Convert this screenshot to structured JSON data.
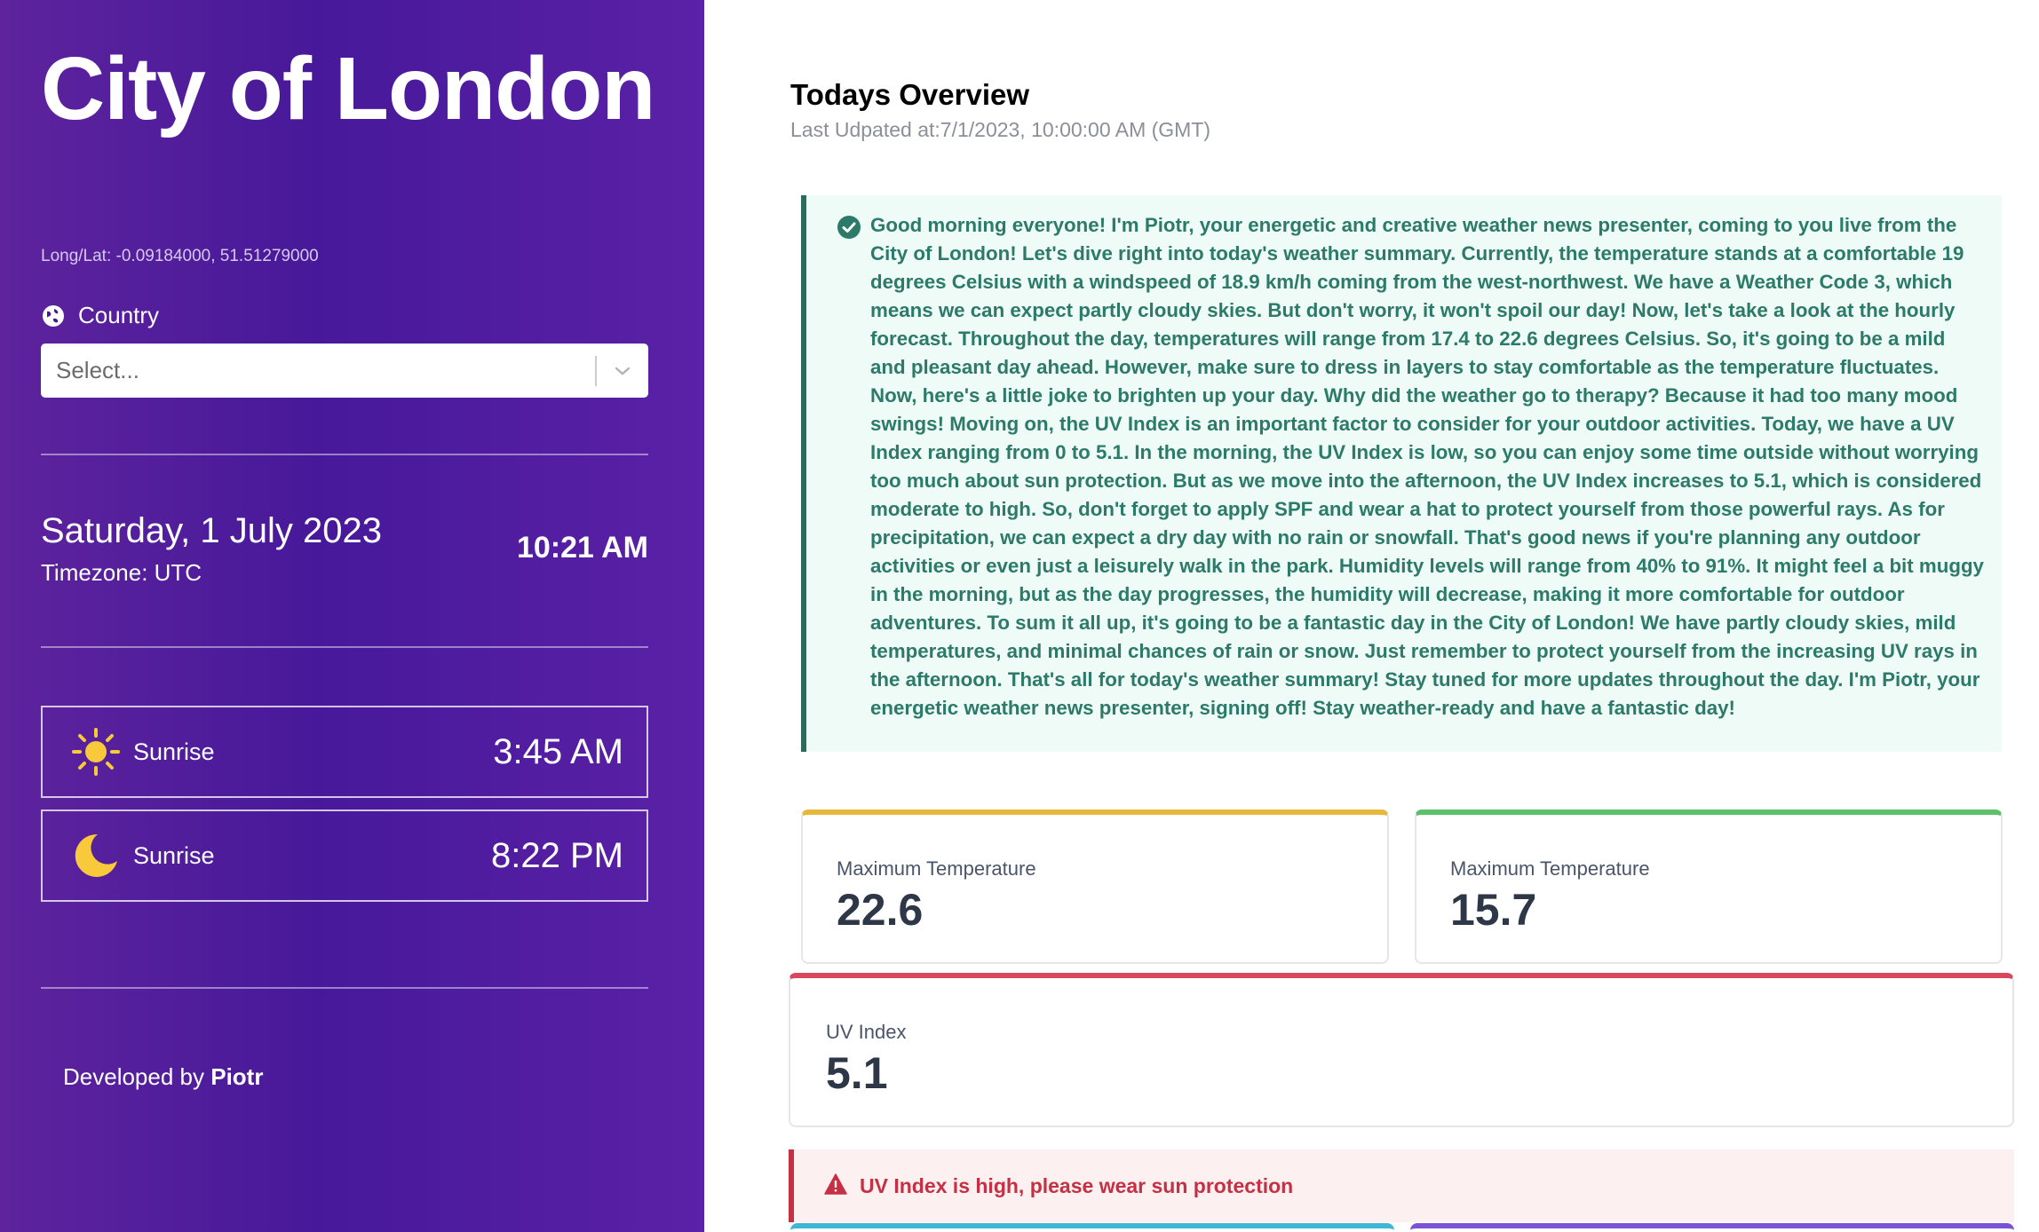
{
  "sidebar": {
    "city": "City of London",
    "coords": "Long/Lat: -0.09184000, 51.51279000",
    "country_label": "Country",
    "country_select": {
      "placeholder": "Select..."
    },
    "date": "Saturday, 1 July 2023",
    "timezone": "Timezone: UTC",
    "time": "10:21 AM",
    "sunrise": {
      "label": "Sunrise",
      "value": "3:45 AM",
      "icon": "sun-icon"
    },
    "sunset": {
      "label": "Sunrise",
      "value": "8:22 PM",
      "icon": "moon-icon"
    },
    "footer_prefix": "Developed by",
    "footer_name": "Piotr"
  },
  "main": {
    "title": "Todays Overview",
    "updated": "Last Udpated at:7/1/2023, 10:00:00 AM (GMT)",
    "summary": "Good morning everyone! I'm Piotr, your energetic and creative weather news presenter, coming to you live from the City of London! Let's dive right into today's weather summary. Currently, the temperature stands at a comfortable 19 degrees Celsius with a windspeed of 18.9 km/h coming from the west-northwest. We have a Weather Code 3, which means we can expect partly cloudy skies. But don't worry, it won't spoil our day! Now, let's take a look at the hourly forecast. Throughout the day, temperatures will range from 17.4 to 22.6 degrees Celsius. So, it's going to be a mild and pleasant day ahead. However, make sure to dress in layers to stay comfortable as the temperature fluctuates. Now, here's a little joke to brighten up your day. Why did the weather go to therapy? Because it had too many mood swings! Moving on, the UV Index is an important factor to consider for your outdoor activities. Today, we have a UV Index ranging from 0 to 5.1. In the morning, the UV Index is low, so you can enjoy some time outside without worrying too much about sun protection. But as we move into the afternoon, the UV Index increases to 5.1, which is considered moderate to high. So, don't forget to apply SPF and wear a hat to protect yourself from those powerful rays. As for precipitation, we can expect a dry day with no rain or snowfall. That's good news if you're planning any outdoor activities or even just a leisurely walk in the park. Humidity levels will range from 40% to 91%. It might feel a bit muggy in the morning, but as the day progresses, the humidity will decrease, making it more comfortable for outdoor adventures. To sum it all up, it's going to be a fantastic day in the City of London! We have partly cloudy skies, mild temperatures, and minimal chances of rain or snow. Just remember to protect yourself from the increasing UV rays in the afternoon. That's all for today's weather summary! Stay tuned for more updates throughout the day. I'm Piotr, your energetic weather news presenter, signing off! Stay weather-ready and have a fantastic day!",
    "stats": [
      {
        "label": "Maximum Temperature",
        "value": "22.6",
        "color": "#e6b93d"
      },
      {
        "label": "Maximum Temperature",
        "value": "15.7",
        "color": "#5cbf6a"
      },
      {
        "label": "UV Index",
        "value": "5.1",
        "color": "#d9475c"
      }
    ],
    "alert": {
      "text": "UV Index is high, please wear sun protection",
      "icon": "warning-icon",
      "color": "#c53043"
    },
    "bottom_colors": [
      "#3fb6d3",
      "#7b52d6"
    ]
  }
}
